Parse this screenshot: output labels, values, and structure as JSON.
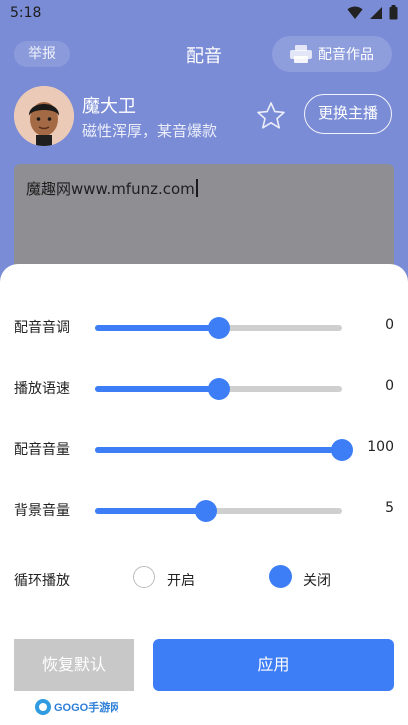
{
  "status_bar": {
    "time": "5:18"
  },
  "header": {
    "report": "举报",
    "title": "配音",
    "works": "配音作品"
  },
  "profile": {
    "name": "魔大卫",
    "description": "磁性浑厚，某音爆款",
    "change": "更换主播"
  },
  "editor": {
    "text": "魔趣网www.mfunz.com"
  },
  "settings": {
    "sliders": [
      {
        "label": "配音音调",
        "value": "0",
        "fraction": 0.5
      },
      {
        "label": "播放语速",
        "value": "0",
        "fraction": 0.5
      },
      {
        "label": "配音音量",
        "value": "100",
        "fraction": 1.0
      },
      {
        "label": "背景音量",
        "value": "5",
        "fraction": 0.45
      }
    ],
    "loop": {
      "label": "循环播放",
      "on": "开启",
      "off": "关闭",
      "selected": "off"
    }
  },
  "actions": {
    "restore": "恢复默认",
    "apply": "应用"
  },
  "colors": {
    "accent": "#3d7ef7",
    "overlay": "#7b8cd6",
    "disabled": "#c8c8c8"
  },
  "watermark": {
    "text": "GOGO手游网"
  }
}
